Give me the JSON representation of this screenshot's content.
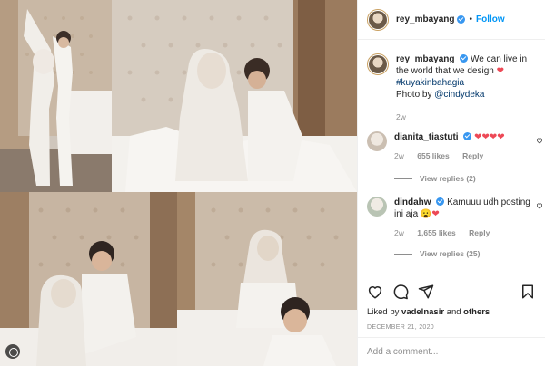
{
  "post": {
    "author": "rey_mbayang",
    "follow_label": "Follow",
    "dot": "•"
  },
  "caption": {
    "username": "rey_mbayang",
    "text": "We can live in the world that we design",
    "emoji": "❤",
    "hashtag": "#kuyakinbahagia",
    "photo_by_prefix": "Photo by ",
    "photo_by_user": "@cindydeka",
    "age": "2w"
  },
  "comments": [
    {
      "username": "dianita_tiastuti",
      "text": "",
      "emoji": "❤❤❤❤",
      "age": "2w",
      "likes": "655 likes",
      "reply_label": "Reply",
      "view_replies": "View replies (2)"
    },
    {
      "username": "dindahw",
      "text": "Kamuuu udh posting ini aja",
      "emoji": "😦❤",
      "age": "2w",
      "likes": "1,655 likes",
      "reply_label": "Reply",
      "view_replies": "View replies (25)"
    }
  ],
  "liked_by": {
    "prefix": "Liked by ",
    "user": "vadelnasir",
    "middle": " and ",
    "others": "others"
  },
  "date": "DECEMBER 21, 2020",
  "add_comment_placeholder": "Add a comment...",
  "icons": {
    "like": "heart-icon",
    "comment": "comment-icon",
    "share": "share-icon",
    "save": "bookmark-icon"
  },
  "colors": {
    "accent": "#0095f6",
    "verified": "#3897f0",
    "heart": "#ed4956",
    "muted": "#8e8e8e"
  }
}
